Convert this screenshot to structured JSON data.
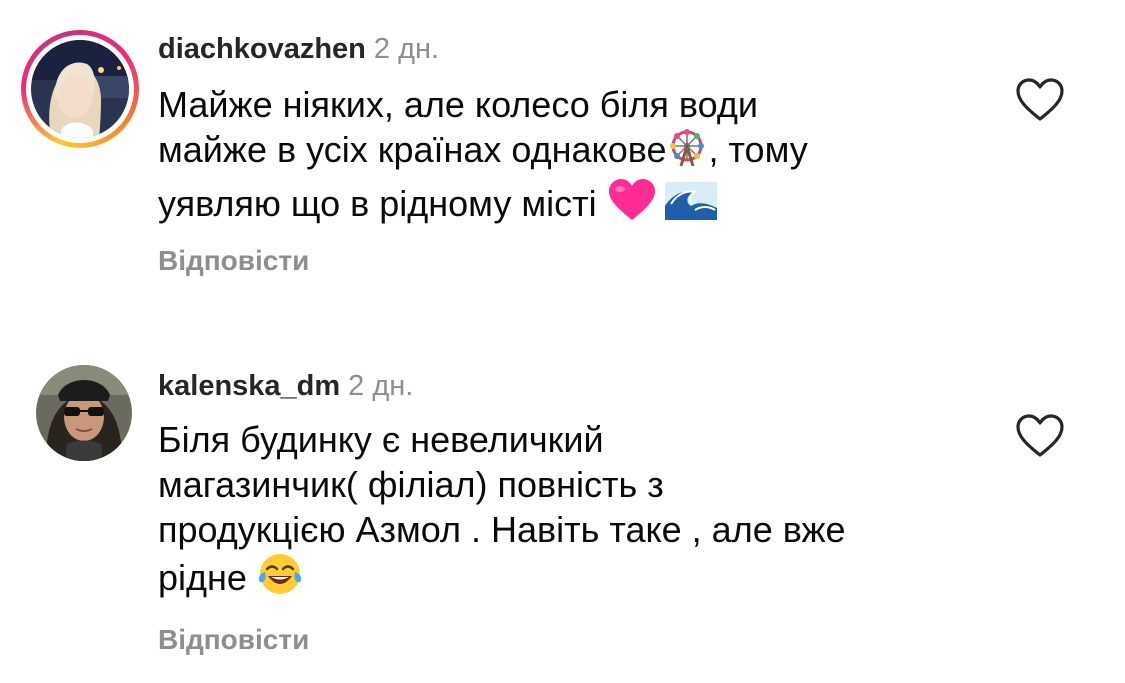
{
  "comments": [
    {
      "username": "diachkovazhen",
      "time": "2 дн.",
      "text_lines": [
        "Майже ніяких, але колесо біля води",
        "майже в усіх країнах однакове",
        ", тому",
        "уявляю що в рідному місті "
      ],
      "emojis": [
        "ferris-wheel",
        "pink-heart",
        "water-wave"
      ],
      "reply_label": "Відповісти",
      "has_story_ring": true
    },
    {
      "username": "kalenska_dm",
      "time": "2 дн.",
      "text_lines": [
        "Біля будинку є невеличкий",
        "магазинчик( філіал) повність з",
        "продукцією Азмол . Навіть таке , але вже",
        "рідне "
      ],
      "emojis": [
        "face-with-tears-of-joy"
      ],
      "reply_label": "Відповісти",
      "has_story_ring": false
    }
  ],
  "colors": {
    "username": "#262626",
    "meta": "#8e8e8e",
    "text": "#0a0a0a",
    "story_ring_start": "#f9ce34",
    "story_ring_mid": "#ee2a7b"
  }
}
